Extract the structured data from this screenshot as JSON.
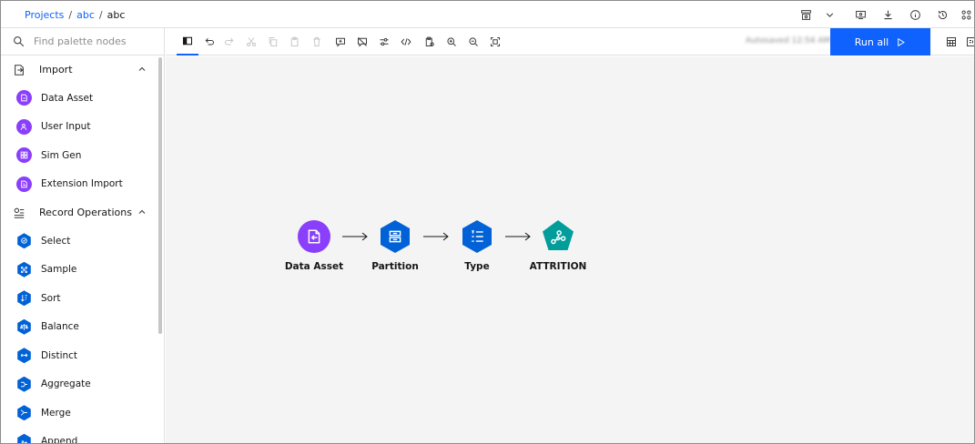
{
  "breadcrumb": {
    "items": [
      "Projects",
      "abc"
    ],
    "separator": "/",
    "current": "abc"
  },
  "sidebar": {
    "search_placeholder": "Find palette nodes",
    "categories": [
      {
        "label": "Import",
        "icon": "import-icon",
        "nodes": [
          {
            "label": "Data Asset",
            "icon": "data-asset-icon"
          },
          {
            "label": "User Input",
            "icon": "user-input-icon"
          },
          {
            "label": "Sim Gen",
            "icon": "sim-gen-icon"
          },
          {
            "label": "Extension Import",
            "icon": "extension-import-icon"
          }
        ]
      },
      {
        "label": "Record Operations",
        "icon": "record-operations-icon",
        "nodes": [
          {
            "label": "Select",
            "icon": "select-icon"
          },
          {
            "label": "Sample",
            "icon": "sample-icon"
          },
          {
            "label": "Sort",
            "icon": "sort-icon"
          },
          {
            "label": "Balance",
            "icon": "balance-icon"
          },
          {
            "label": "Distinct",
            "icon": "distinct-icon"
          },
          {
            "label": "Aggregate",
            "icon": "aggregate-icon"
          },
          {
            "label": "Merge",
            "icon": "merge-icon"
          },
          {
            "label": "Append",
            "icon": "append-icon"
          }
        ]
      }
    ]
  },
  "toolbar": {
    "autosave_text": "Autosaved 12:54 AM",
    "run_all_label": "Run all"
  },
  "flow": {
    "nodes": [
      {
        "label": "Data Asset",
        "icon": "data-asset-icon",
        "color": "#8a3ffc"
      },
      {
        "label": "Partition",
        "icon": "partition-icon",
        "color": "#0062d6"
      },
      {
        "label": "Type",
        "icon": "type-icon",
        "color": "#0062d6"
      },
      {
        "label": "ATTRITION",
        "icon": "model-nugget-icon",
        "color": "#009d9a"
      }
    ]
  },
  "colors": {
    "accent": "#0f62fe",
    "import_node": "#8a3ffc",
    "record_node": "#0062d6",
    "model_node": "#009d9a",
    "canvas_bg": "#f4f4f4"
  }
}
